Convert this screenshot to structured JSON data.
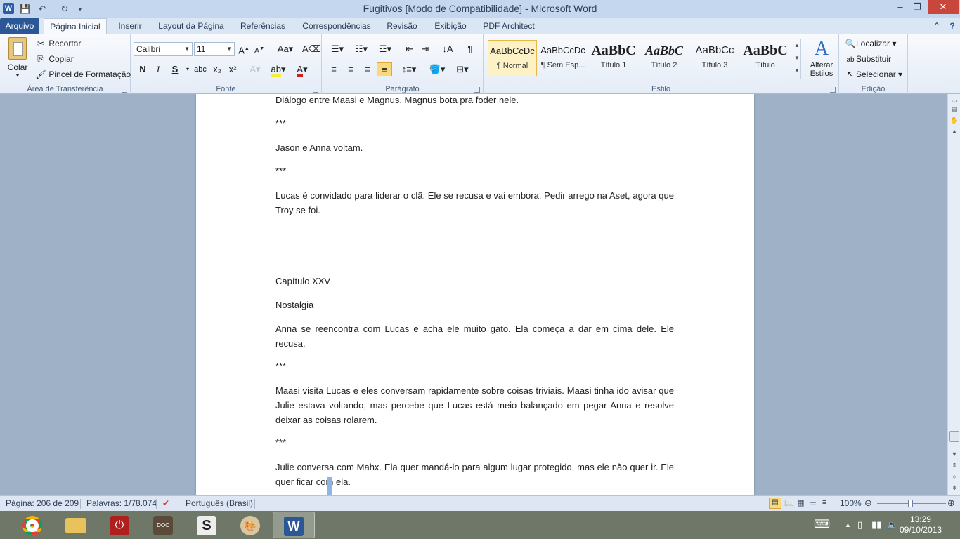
{
  "window": {
    "title": "Fugitivos [Modo de Compatibilidade]  -  Microsoft Word",
    "app_icon": "W",
    "minimize": "–",
    "maximize": "❐",
    "close": "✕"
  },
  "tabs": [
    {
      "label": "Arquivo"
    },
    {
      "label": "Página Inicial"
    },
    {
      "label": "Inserir"
    },
    {
      "label": "Layout da Página"
    },
    {
      "label": "Referências"
    },
    {
      "label": "Correspondências"
    },
    {
      "label": "Revisão"
    },
    {
      "label": "Exibição"
    },
    {
      "label": "PDF Architect"
    }
  ],
  "clipboard": {
    "paste": "Colar",
    "cut": "Recortar",
    "copy": "Copiar",
    "format_painter": "Pincel de Formatação",
    "label": "Área de Transferência"
  },
  "font": {
    "name": "Calibri",
    "size": "11",
    "bold": "N",
    "italic": "I",
    "underline": "S",
    "strike": "abc",
    "subscript": "x₂",
    "superscript": "x²",
    "label": "Fonte"
  },
  "paragraph": {
    "label": "Parágrafo"
  },
  "styles": {
    "items": [
      {
        "sample": "AaBbCcDc",
        "name": "¶ Normal"
      },
      {
        "sample": "AaBbCcDc",
        "name": "¶ Sem Esp..."
      },
      {
        "sample": "AaBbC",
        "name": "Título 1"
      },
      {
        "sample": "AaBbC",
        "name": "Título 2"
      },
      {
        "sample": "AaBbCc",
        "name": "Título 3"
      },
      {
        "sample": "AaBbC",
        "name": "Título"
      }
    ],
    "change_styles": "Alterar Estilos",
    "label": "Estilo"
  },
  "editing": {
    "find": "Localizar",
    "replace": "Substituir",
    "select": "Selecionar",
    "label": "Edição"
  },
  "document": {
    "paragraphs": [
      "Diálogo entre Maasi e Magnus. Magnus bota pra foder nele.",
      "***",
      "Jason e Anna voltam.",
      "***",
      "Lucas é convidado para liderar o clã. Ele se recusa e vai embora. Pedir arrego na Aset, agora que Troy se foi.",
      "Capítulo XXV",
      "Nostalgia",
      "Anna se reencontra com Lucas e acha ele muito gato. Ela começa a dar em cima dele. Ele recusa.",
      "***",
      "Maasi visita Lucas e eles conversam rapidamente sobre coisas triviais. Maasi tinha ido avisar que Julie estava voltando, mas percebe que Lucas está meio balançado em pegar Anna e resolve deixar as coisas rolarem.",
      "***",
      "Julie conversa com Mahx. Ela quer mandá-lo para algum lugar protegido, mas ele não quer ir. Ele quer ficar com ela."
    ]
  },
  "status": {
    "page": "Página: 206 de 209",
    "words": "Palavras: 1/78.074",
    "language": "Português (Brasil)",
    "zoom": "100%"
  },
  "taskbar": {
    "clock_time": "13:29",
    "clock_date": "09/10/2013"
  }
}
